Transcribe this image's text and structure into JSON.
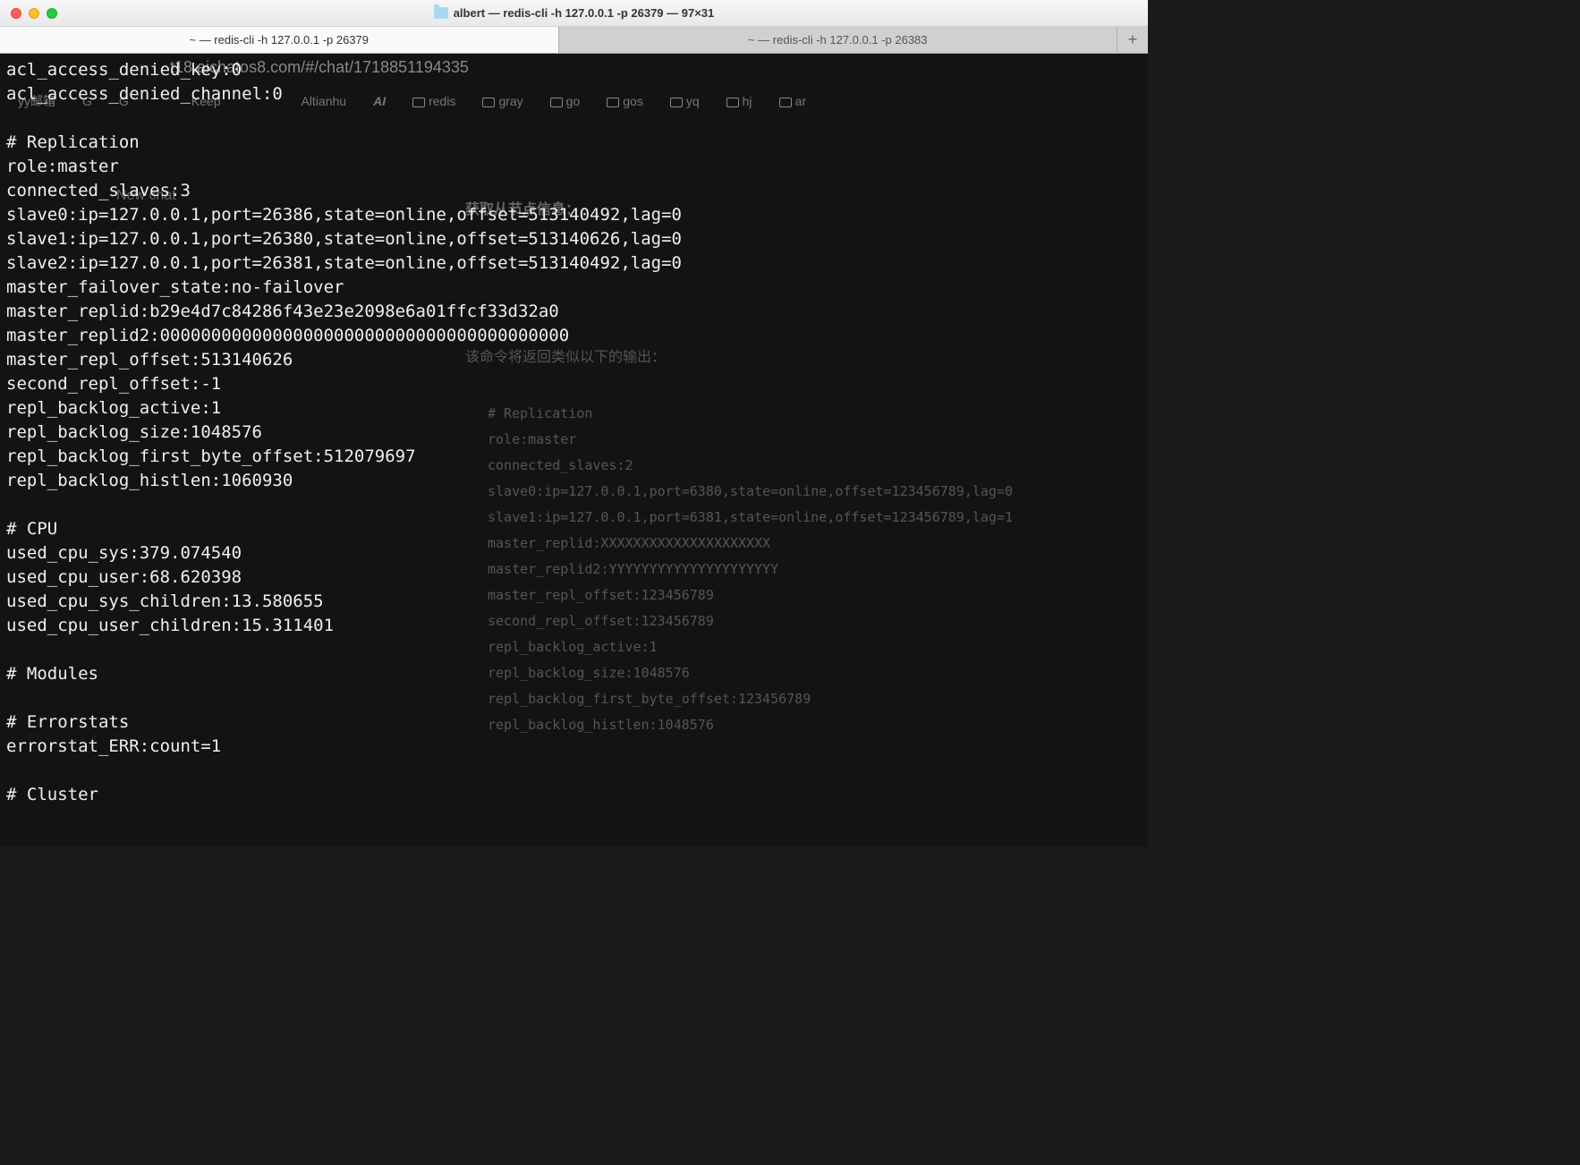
{
  "window": {
    "title": "albert — redis-cli -h 127.0.0.1 -p 26379 — 97×31"
  },
  "tabs": {
    "active": "~ — redis-cli -h 127.0.0.1 -p 26379",
    "inactive": "~ — redis-cli -h 127.0.0.1 -p 26383",
    "newtab": "+"
  },
  "terminal": {
    "lines": "acl_access_denied_key:0\nacl_access_denied_channel:0\n\n# Replication\nrole:master\nconnected_slaves:3\nslave0:ip=127.0.0.1,port=26386,state=online,offset=513140492,lag=0\nslave1:ip=127.0.0.1,port=26380,state=online,offset=513140626,lag=0\nslave2:ip=127.0.0.1,port=26381,state=online,offset=513140492,lag=0\nmaster_failover_state:no-failover\nmaster_replid:b29e4d7c84286f43e23e2098e6a01ffcf33d32a0\nmaster_replid2:0000000000000000000000000000000000000000\nmaster_repl_offset:513140626\nsecond_repl_offset:-1\nrepl_backlog_active:1\nrepl_backlog_size:1048576\nrepl_backlog_first_byte_offset:512079697\nrepl_backlog_histlen:1060930\n\n# CPU\nused_cpu_sys:379.074540\nused_cpu_user:68.620398\nused_cpu_sys_children:13.580655\nused_cpu_user_children:15.311401\n\n# Modules\n\n# Errorstats\nerrorstat_ERR:count=1\n\n# Cluster"
  },
  "background": {
    "url": "t18.aichatos8.com/#/chat/1718851194335",
    "bookmarks": {
      "b0": "yy邮箱",
      "b1": "G",
      "b2": "G",
      "b3": "Keep",
      "b4": "Altianhu",
      "b5": "AI",
      "b6": "redis",
      "b7": "gray",
      "b8": "go",
      "b9": "gos",
      "b10": "yq",
      "b11": "hj",
      "b12": "ar"
    },
    "sidebar_newchat": "New chat",
    "heading1": "获取从节点信息：",
    "heading2": "该命令将返回类似以下的输出：",
    "code": "# Replication\nrole:master\nconnected_slaves:2\nslave0:ip=127.0.0.1,port=6380,state=online,offset=123456789,lag=0\nslave1:ip=127.0.0.1,port=6381,state=online,offset=123456789,lag=1\nmaster_replid:XXXXXXXXXXXXXXXXXXXXX\nmaster_replid2:YYYYYYYYYYYYYYYYYYYYY\nmaster_repl_offset:123456789\nsecond_repl_offset:123456789\nrepl_backlog_active:1\nrepl_backlog_size:1048576\nrepl_backlog_first_byte_offset:123456789\nrepl_backlog_histlen:1048576"
  }
}
